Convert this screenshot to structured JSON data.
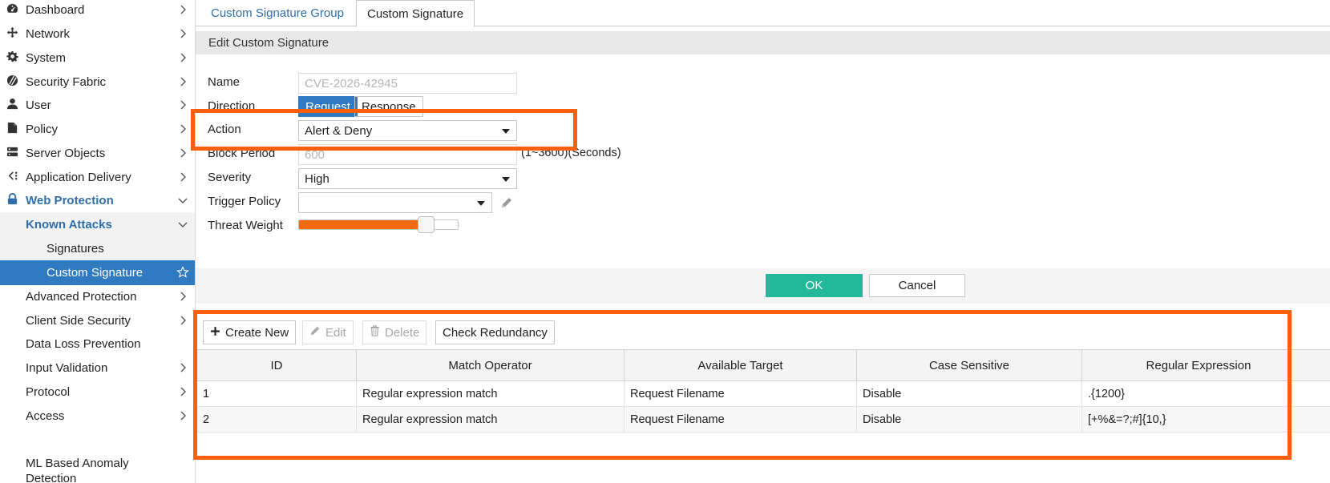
{
  "sidebar": {
    "items": [
      {
        "label": "Dashboard"
      },
      {
        "label": "Network"
      },
      {
        "label": "System"
      },
      {
        "label": "Security Fabric"
      },
      {
        "label": "User"
      },
      {
        "label": "Policy"
      },
      {
        "label": "Server Objects"
      },
      {
        "label": "Application Delivery"
      },
      {
        "label": "Web Protection"
      },
      {
        "label": "Known Attacks"
      },
      {
        "label": "Signatures"
      },
      {
        "label": "Custom Signature"
      },
      {
        "label": "Advanced Protection"
      },
      {
        "label": "Client Side Security"
      },
      {
        "label": "Data Loss Prevention"
      },
      {
        "label": "Input Validation"
      },
      {
        "label": "Protocol"
      },
      {
        "label": "Access"
      },
      {
        "label": "ML Based Anomaly Detection"
      }
    ]
  },
  "tabs": [
    {
      "label": "Custom Signature Group"
    },
    {
      "label": "Custom Signature"
    }
  ],
  "section": {
    "title": "Edit Custom Signature"
  },
  "form": {
    "name_label": "Name",
    "name_placeholder": "CVE-2026-42945",
    "direction_label": "Direction",
    "direction_options": [
      "Request",
      "Response"
    ],
    "direction_selected": "Request",
    "action_label": "Action",
    "action_value": "Alert & Deny",
    "block_period_label": "Block Period",
    "block_period_value": "600",
    "block_period_hint": "(1~3600)(Seconds)",
    "severity_label": "Severity",
    "severity_value": "High",
    "trigger_policy_label": "Trigger Policy",
    "trigger_policy_value": "",
    "threat_weight_label": "Threat Weight",
    "threat_weight_fraction": 0.76
  },
  "buttons": {
    "ok": "OK",
    "cancel": "Cancel"
  },
  "toolbar": {
    "create_new": "Create New",
    "edit": "Edit",
    "delete": "Delete",
    "check_redundancy": "Check Redundancy"
  },
  "table": {
    "columns": [
      "ID",
      "Match Operator",
      "Available Target",
      "Case Sensitive",
      "Regular Expression"
    ],
    "rows": [
      {
        "id": "1",
        "operator": "Regular expression match",
        "target": "Request Filename",
        "case": "Disable",
        "regex": ".{1200}"
      },
      {
        "id": "2",
        "operator": "Regular expression match",
        "target": "Request Filename",
        "case": "Disable",
        "regex": "[+%&=?;#]{10,}"
      }
    ]
  },
  "colors": {
    "accent": "#2f7ac0",
    "ok": "#21b99a",
    "highlight": "#fa5f0c",
    "slider": "#f36b0c"
  }
}
